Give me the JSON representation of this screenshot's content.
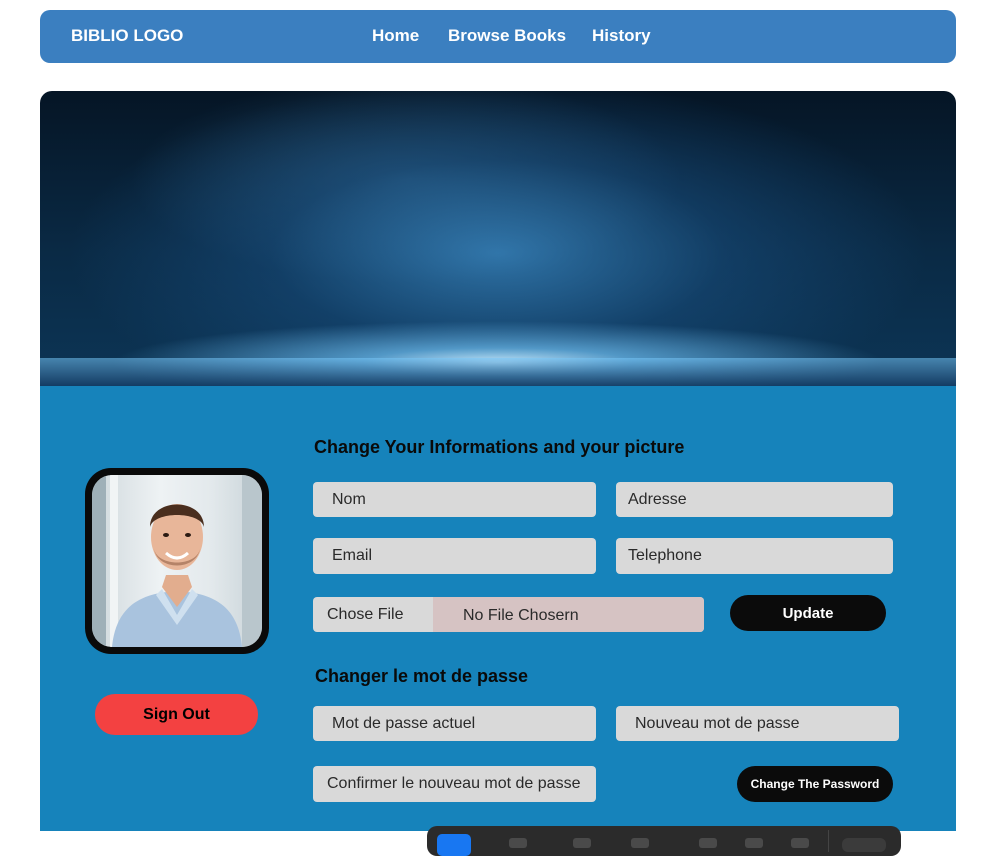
{
  "nav": {
    "logo": "BIBLIO LOGO",
    "links": [
      "Home",
      "Browse Books",
      "History"
    ]
  },
  "profile": {
    "sign_out_label": "Sign Out"
  },
  "info_form": {
    "heading": "Change  Your Informations and your picture",
    "nom_placeholder": "Nom",
    "adresse_placeholder": "Adresse",
    "email_placeholder": "Email",
    "telephone_placeholder": "Telephone",
    "file_button_label": "Chose File",
    "file_status": "No File Chosern",
    "update_label": "Update"
  },
  "password_form": {
    "heading": "Changer le mot de passe",
    "current_placeholder": "Mot de passe actuel",
    "new_placeholder": "Nouveau mot de passe",
    "confirm_placeholder": "Confirmer le nouveau mot de passe",
    "submit_label": "Change The Password"
  },
  "colors": {
    "navbar": "#3b7fc0",
    "panel": "#1683bb",
    "sign_out": "#f34141",
    "button_dark": "#0b0b0b"
  }
}
